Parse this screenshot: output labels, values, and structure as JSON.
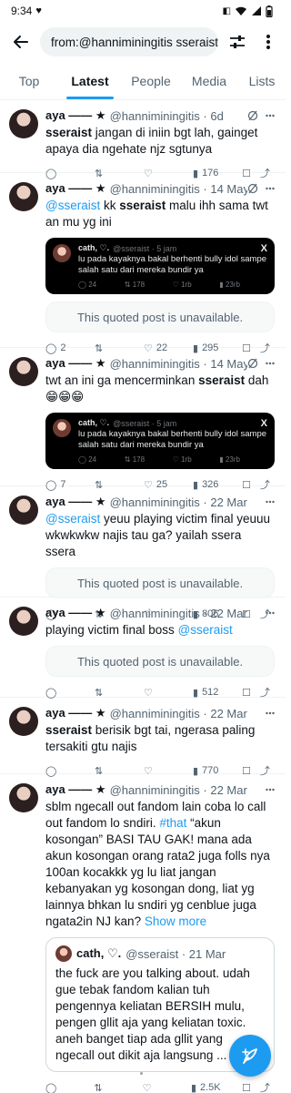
{
  "status": {
    "time": "9:34"
  },
  "search": {
    "query": "from:@hanniminingitis sseraist"
  },
  "tabs": [
    "Top",
    "Latest",
    "People",
    "Media",
    "Lists"
  ],
  "author": {
    "name": "aya —— ★",
    "handle": "@hanniminingitis"
  },
  "tweets": [
    {
      "time": "6d",
      "views": "176",
      "replies": "",
      "likes": ""
    },
    {
      "time": "14 May",
      "views": "295",
      "replies": "2",
      "likes": "22"
    },
    {
      "time": "14 May",
      "views": "326",
      "replies": "7",
      "likes": "25"
    },
    {
      "time": "22 Mar",
      "views": "806"
    },
    {
      "time": "22 Mar",
      "views": "512"
    },
    {
      "time": "22 Mar",
      "views": "770"
    },
    {
      "time": "22 Mar",
      "views": "2.5K"
    }
  ],
  "text": {
    "t1_hl": "sseraist",
    "t1": " jangan di iniin bgt lah, gainget apaya dia ngehate njz sgtunya",
    "t2_mention": "@sseraist",
    "t2_mid": " kk ",
    "t2_hl": "sseraist",
    "t2": " malu ihh sama twt an mu yg ini",
    "t3": "twt an ini ga mencerminkan ",
    "t3_hl": "sseraist",
    "t3_end": " dah😁😁😁",
    "t4_mention": "@sseraist",
    "t4": " yeuu playing victim final yeuuu wkwkwkw najis tau ga? yailah ssera ssera",
    "t5": "playing victim final boss ",
    "t5_mention": "@sseraist",
    "t6_hl": "sseraist",
    "t6": " berisik bgt tai, ngerasa paling tersakiti gtu najis",
    "t7a": "sblm ngecall out fandom lain coba lo call out fandom lo sndiri. ",
    "t7_tag": "#that",
    "t7b": " “akun kosongan” BASI TAU GAK! mana ada akun kosongan orang rata2 juga folls nya 100an kocakkk yg lu liat jangan kebanyakan yg kosongan dong, liat yg lainnya bhkan lu sndiri yg cenblue juga ngata2in NJ kan? ",
    "t7_more": "Show more"
  },
  "unavailable": "This quoted post is unavailable.",
  "embed": {
    "name": "cath, ♡.",
    "meta": "@sseraist · 5 jam",
    "text": "lu pada kayaknya bakal berhenti bully idol sampe salah satu dari mereka bundir ya",
    "replies": "24",
    "retweets": "178",
    "likes": "1rb",
    "views": "23rb"
  },
  "quote": {
    "name": "cath, ♡.",
    "meta": "@sseraist · 21 Mar",
    "text": "the fuck are you talking about. udah gue tebak fandom kalian tuh pengennya keliatan BERSIH mulu, pengen gllit aja yang keliatan toxic. aneh banget tiap ada gllit yang ngecall out dikit aja langsung ..."
  }
}
